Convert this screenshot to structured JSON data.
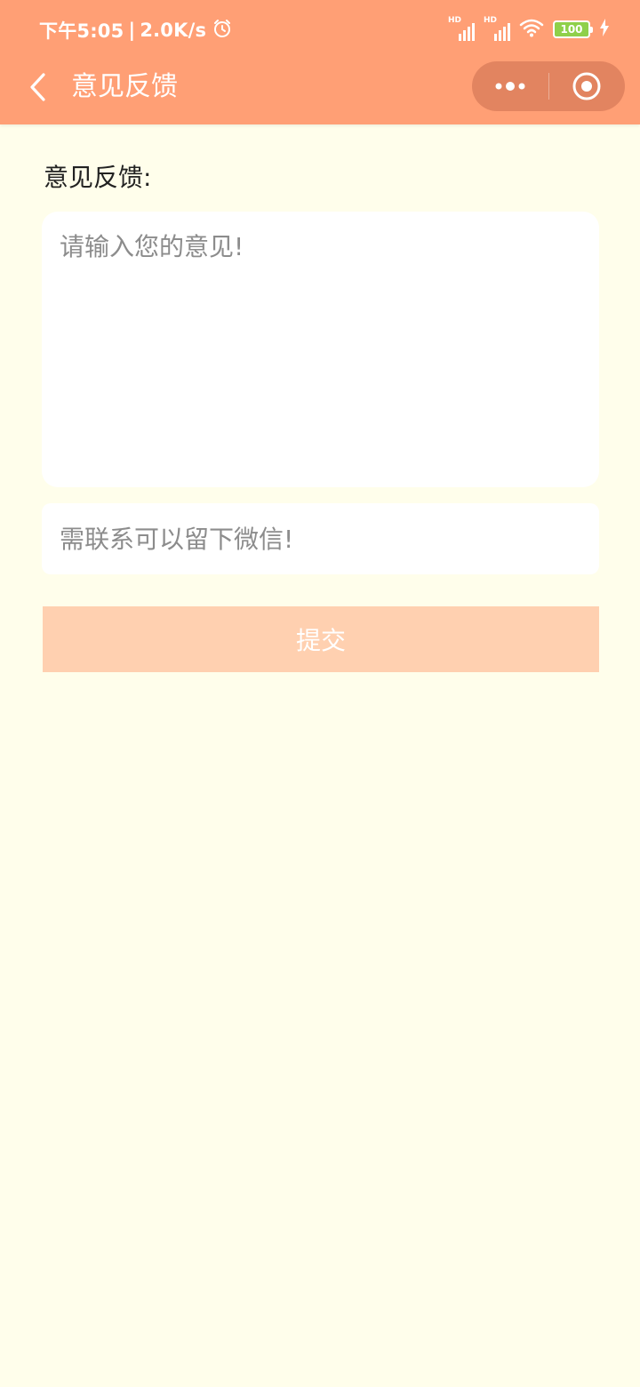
{
  "status_bar": {
    "time": "下午5:05",
    "separator": "|",
    "net_speed": "2.0K/s",
    "sim1_tag": "HD",
    "sim2_tag": "HD",
    "battery": "100"
  },
  "nav": {
    "title": "意见反馈"
  },
  "form": {
    "label": "意见反馈:",
    "feedback_placeholder": "请输入您的意见!",
    "contact_placeholder": "需联系可以留下微信!",
    "submit_label": "提交"
  },
  "colors": {
    "header_bg": "#ff9f75",
    "page_bg": "#fffeeb",
    "submit_bg": "#ffd0b0"
  }
}
